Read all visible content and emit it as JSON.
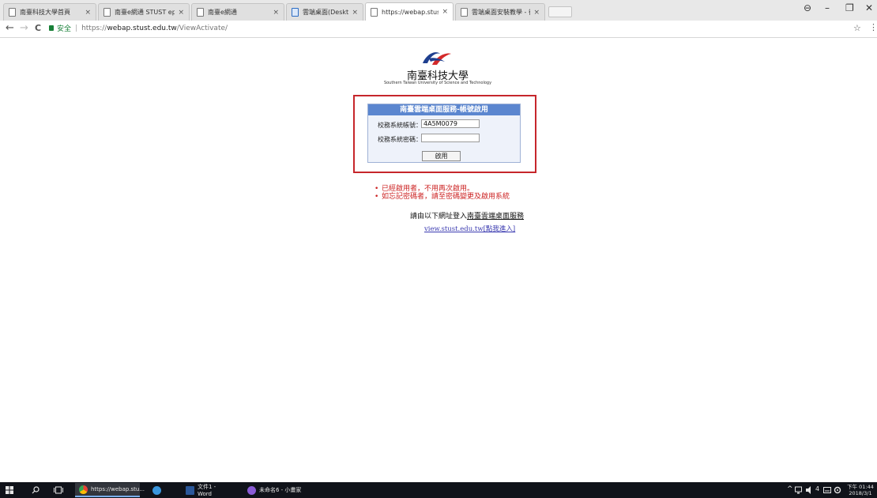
{
  "browser": {
    "tabs": [
      {
        "title": "南臺科技大學首頁",
        "favicon": "page-icon"
      },
      {
        "title": "南臺e網通 STUST eporta",
        "favicon": "page-icon"
      },
      {
        "title": "南臺e網通",
        "favicon": "page-icon"
      },
      {
        "title": "雲端桌面(Desktop) - 南",
        "favicon": "page-icon-blue"
      },
      {
        "title": "https://webap.stust.ed",
        "favicon": "page-icon"
      },
      {
        "title": "雲端桌面安裝教學 - 後台",
        "favicon": "page-icon"
      }
    ],
    "active_tab_index": 4,
    "close_glyph": "×",
    "window_controls": {
      "profile": "⊖",
      "minimize": "–",
      "maximize": "❐",
      "close": "✕"
    },
    "nav": {
      "back": "←",
      "forward": "→",
      "reload": "C"
    },
    "address": {
      "secure_label": "安全",
      "separator": "|",
      "scheme": "https://",
      "host": "webap.stust.edu.tw",
      "path": "/ViewActivate/"
    },
    "bookmark_icon": "☆",
    "menu_icon": "⋮"
  },
  "page": {
    "university_name": "南臺科技大學",
    "university_name_en": "Southern Taiwan University of Science and Technology",
    "login": {
      "header": "南臺雲端桌面服務-帳號啟用",
      "account_label": "校務系統帳號：",
      "account_value": "4A5M0079",
      "password_label": "校務系統密碼：",
      "password_value": "",
      "submit_label": "啟用"
    },
    "notes": [
      "已經啟用者，不用再次啟用。",
      "如忘記密碼者，請至密碼變更及啟用系統"
    ],
    "link_prefix": "請由以下網址登入",
    "link_service": "南臺雲端桌面服務",
    "view_link": "view.stust.edu.tw[點我進入]"
  },
  "taskbar": {
    "apps": [
      {
        "label": "https://webap.stu...",
        "icon": "chrome-icon",
        "color": "#e94235",
        "active": true
      },
      {
        "label": "",
        "icon": "edge-icon",
        "color": "#3a96dd",
        "active": false
      },
      {
        "label": "文件1 - Word",
        "icon": "word-icon",
        "color": "#2b579a",
        "active": false
      },
      {
        "label": "未命名6 - 小畫家",
        "icon": "paint-icon",
        "color": "#8a5bd6",
        "active": false
      }
    ],
    "tray": {
      "ime_left": "4",
      "ime_main": "中"
    },
    "clock_time": "下午 01:44",
    "clock_date": "2018/3/1"
  }
}
